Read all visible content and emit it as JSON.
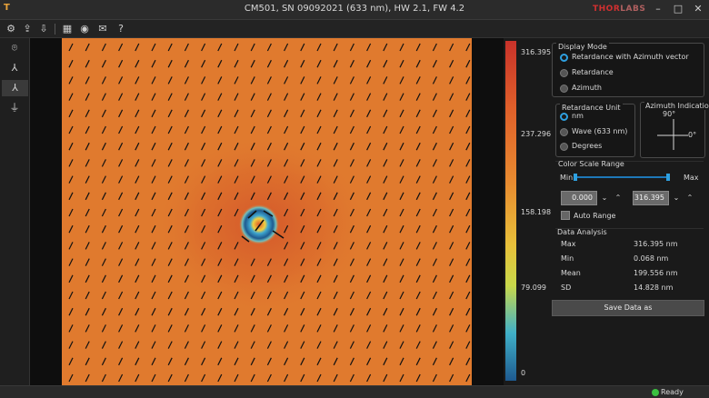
{
  "window": {
    "logo": "T",
    "title": "CM501, SN 09092021 (633 nm), HW 2.1, FW 4.2",
    "brand_a": "THOR",
    "brand_b": "LABS",
    "minimize": "–",
    "maximize": "□",
    "close": "✕"
  },
  "toolbar": {
    "icons": [
      "connect-icon",
      "export-icon",
      "import-icon",
      "camera-settings-icon",
      "calibrate-icon",
      "report-icon",
      "help-icon"
    ],
    "glyphs": [
      "⚙",
      "⇪",
      "⇩",
      "▦",
      "◉",
      "✉",
      "?"
    ]
  },
  "leftbar": {
    "glyphs": [
      "⌾",
      "⅄",
      "⅄",
      "⏚"
    ]
  },
  "colorbar": {
    "ticks": [
      "316.395",
      "237.296",
      "158.198",
      "79.099",
      "0"
    ]
  },
  "display_mode": {
    "title": "Display Mode",
    "options": [
      "Retardance with Azimuth vector",
      "Retardance",
      "Azimuth"
    ],
    "selected": 0
  },
  "retardance_unit": {
    "title": "Retardance Unit",
    "options": [
      "nm",
      "Wave (633 nm)",
      "Degrees"
    ],
    "selected": 0
  },
  "azimuth_indication": {
    "title": "Azimuth Indication",
    "label_90": "90°",
    "label_0": "0°"
  },
  "color_scale": {
    "title": "Color Scale Range",
    "min_label": "Min",
    "max_label": "Max",
    "min_value": "0.000",
    "max_value": "316.395",
    "auto_range_label": "Auto Range",
    "down": "⌄",
    "up": "⌃"
  },
  "data_analysis": {
    "title": "Data Analysis",
    "rows": [
      {
        "label": "Max",
        "value": "316.395 nm"
      },
      {
        "label": "Min",
        "value": "0.068 nm"
      },
      {
        "label": "Mean",
        "value": "199.556 nm"
      },
      {
        "label": "SD",
        "value": "14.828 nm"
      }
    ]
  },
  "save_button": "Save Data as",
  "status": {
    "ready": "Ready"
  },
  "colors": {
    "accent": "#2ea0e0",
    "map": "#e07a2e",
    "brand": "#d23030"
  }
}
